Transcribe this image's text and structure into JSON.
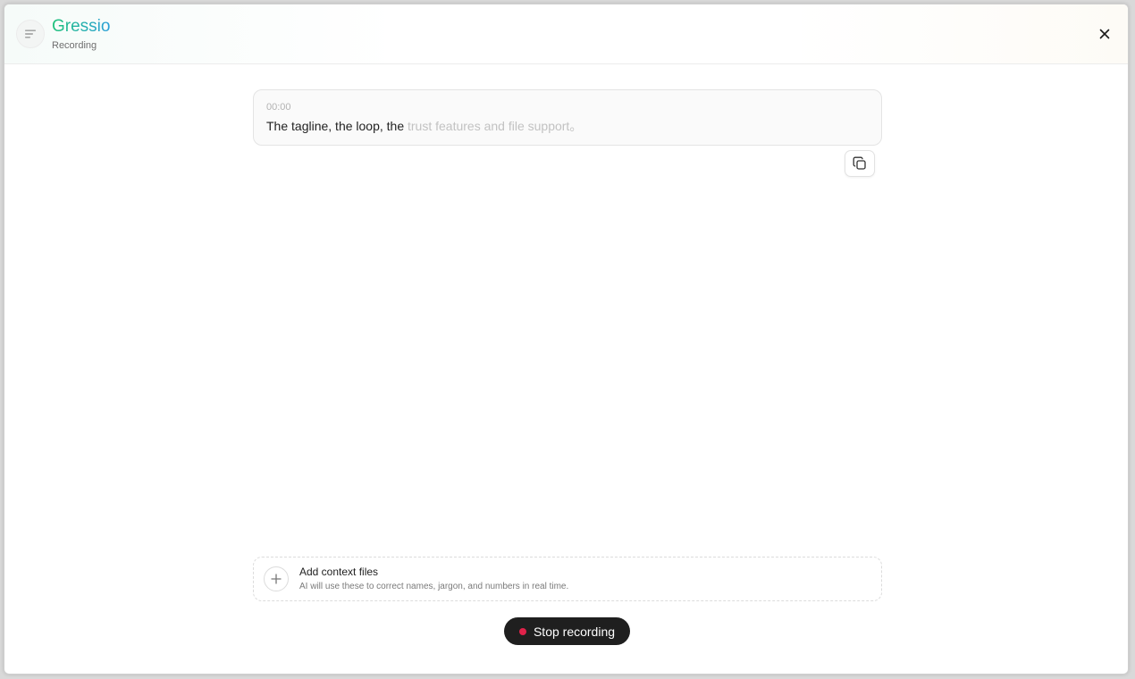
{
  "header": {
    "title": "Gressio",
    "subtitle": "Recording"
  },
  "transcript": {
    "timestamp": "00:00",
    "text_confirmed": "The tagline, the loop, the ",
    "text_pending": "trust features and file support。"
  },
  "context_files": {
    "title": "Add context files",
    "description": "AI will use these to correct names, jargon, and numbers in real time."
  },
  "controls": {
    "stop_label": "Stop recording"
  },
  "icons": {
    "menu": "menu-lines-icon",
    "close": "close-icon",
    "copy": "copy-icon",
    "add": "plus-icon",
    "record": "record-dot-icon"
  },
  "colors": {
    "brand_start": "#1ec27a",
    "brand_end": "#2a9fd8",
    "record_dot": "#e0224a",
    "stop_button_bg": "#1f1f1f"
  }
}
